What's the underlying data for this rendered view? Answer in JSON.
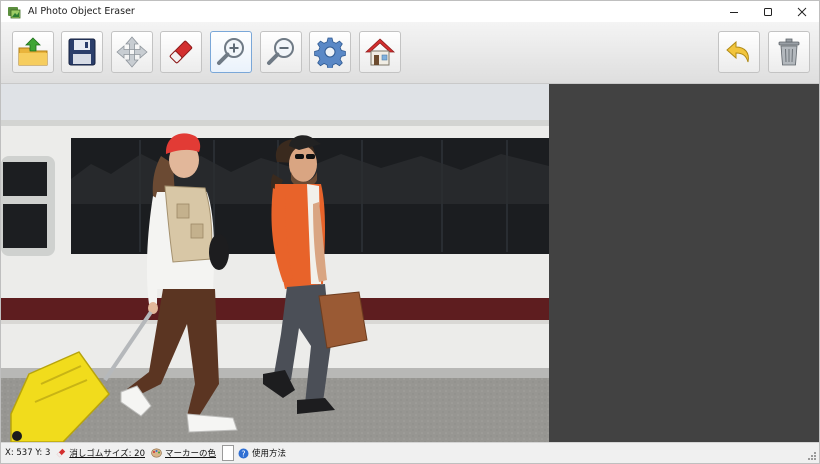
{
  "app": {
    "title": "AI Photo Object Eraser",
    "icon": "app-logo-icon"
  },
  "window_controls": {
    "minimize": "minimize-icon",
    "maximize": "maximize-icon",
    "close": "close-icon"
  },
  "toolbar": {
    "buttons": [
      {
        "name": "open-button",
        "icon": "open-folder-icon"
      },
      {
        "name": "save-button",
        "icon": "floppy-disk-icon"
      },
      {
        "name": "move-button",
        "icon": "move-arrows-icon"
      },
      {
        "name": "eraser-button",
        "icon": "eraser-icon"
      },
      {
        "name": "zoom-in-button",
        "icon": "zoom-in-icon",
        "active": true
      },
      {
        "name": "zoom-out-button",
        "icon": "zoom-out-icon"
      },
      {
        "name": "settings-button",
        "icon": "gear-icon"
      },
      {
        "name": "home-button",
        "icon": "home-icon"
      },
      {
        "name": "undo-button",
        "icon": "undo-arrow-icon"
      },
      {
        "name": "delete-button",
        "icon": "trash-icon"
      }
    ]
  },
  "canvas": {
    "image": "photo of two people walking with luggage beside a train",
    "background": "#424242"
  },
  "status": {
    "coords": "X: 537 Y: 3",
    "eraser_size_label": "消しゴムサイズ: 20",
    "marker_color_label": "マーカーの色",
    "marker_color": "#ffffff",
    "help_label": "使用方法"
  }
}
